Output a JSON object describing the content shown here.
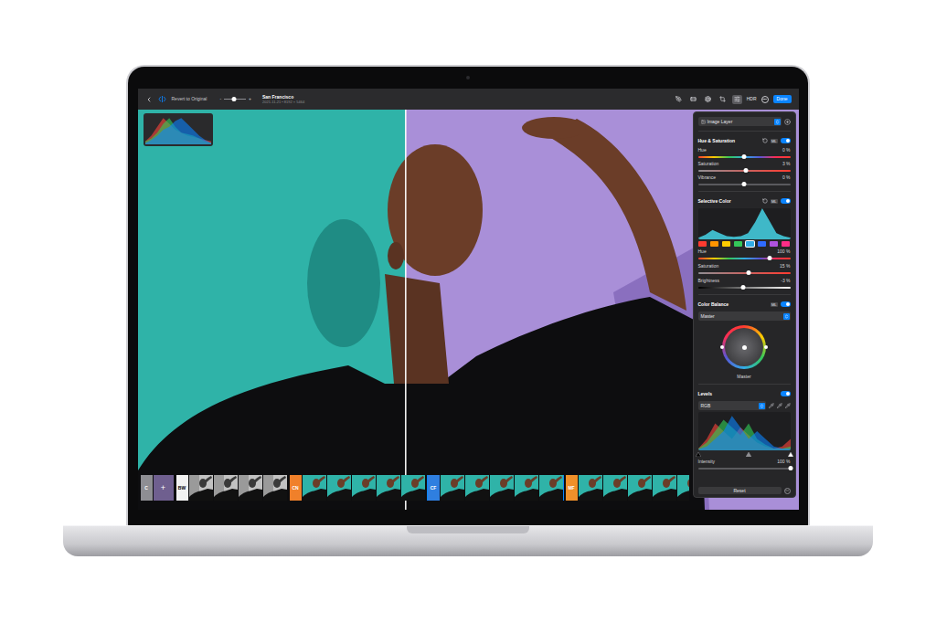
{
  "toolbar": {
    "revert": "Revert to Original",
    "zoom": {
      "minus": "-",
      "plus": "+",
      "level": 0.45
    },
    "title": "San Francisco",
    "subtitle": "2021-11-21 • 8192 × 5464",
    "tools": [
      {
        "selected": false
      },
      {
        "selected": false
      },
      {
        "selected": false
      },
      {
        "selected": false
      },
      {
        "selected": true
      }
    ],
    "hdr": "HDR",
    "done": "Done"
  },
  "canvas": {
    "split": 0.405,
    "histogram": {
      "red": [
        0.1,
        0.3,
        0.6,
        0.9,
        0.7,
        0.5,
        0.4,
        0.3,
        0.25,
        0.2,
        0.15,
        0.1
      ],
      "green": [
        0.1,
        0.2,
        0.4,
        0.7,
        0.9,
        0.6,
        0.4,
        0.35,
        0.3,
        0.2,
        0.1,
        0.05
      ],
      "blue": [
        0.05,
        0.15,
        0.3,
        0.5,
        0.6,
        0.8,
        0.9,
        0.7,
        0.5,
        0.3,
        0.15,
        0.05
      ]
    }
  },
  "inspector": {
    "layer": "Image Layer",
    "hue_saturation": {
      "title": "Hue & Saturation",
      "ml": "ML",
      "resettable": true,
      "enabled": true,
      "sliders": [
        {
          "label": "Hue",
          "reading": "0 %",
          "level": 0.5,
          "kind": "hue"
        },
        {
          "label": "Saturation",
          "reading": "3 %",
          "level": 0.52,
          "kind": "saturation"
        },
        {
          "label": "Vibrance",
          "reading": "0 %",
          "level": 0.5,
          "kind": "plain"
        }
      ]
    },
    "selective_color": {
      "title": "Selective Color",
      "ml": "ML",
      "resettable": true,
      "enabled": true,
      "histogram": [
        0.05,
        0.15,
        0.3,
        0.2,
        0.1,
        0.08,
        0.1,
        0.2,
        0.55,
        1.0,
        0.6,
        0.2,
        0.1,
        0.05
      ],
      "swatches": [
        {
          "color": "#ff3b30",
          "selected": false
        },
        {
          "color": "#ff9500",
          "selected": false
        },
        {
          "color": "#ffcc00",
          "selected": false
        },
        {
          "color": "#34c759",
          "selected": false
        },
        {
          "color": "#32ade6",
          "selected": true
        },
        {
          "color": "#2f6bff",
          "selected": false
        },
        {
          "color": "#af52de",
          "selected": false
        },
        {
          "color": "#ff2d87",
          "selected": false
        }
      ],
      "sliders": [
        {
          "label": "Hue",
          "reading": "100 %",
          "level": 0.78,
          "kind": "hue"
        },
        {
          "label": "Saturation",
          "reading": "15 %",
          "level": 0.55,
          "kind": "saturation"
        },
        {
          "label": "Brightness",
          "reading": "-3 %",
          "level": 0.49,
          "kind": "brightness"
        }
      ]
    },
    "color_balance": {
      "title": "Color Balance",
      "ml": "ML",
      "resettable": false,
      "enabled": true,
      "mode": "Master",
      "wheel_label": "Master"
    },
    "levels": {
      "title": "Levels",
      "enabled": true,
      "channel": "RGB",
      "histogram": {
        "red": [
          0.05,
          0.3,
          0.7,
          0.5,
          0.3,
          0.6,
          0.4,
          0.2,
          0.1,
          0.05,
          0.1,
          0.3
        ],
        "green": [
          0.05,
          0.2,
          0.5,
          0.8,
          0.6,
          0.4,
          0.7,
          0.3,
          0.15,
          0.05,
          0.05,
          0.1
        ],
        "blue": [
          0.03,
          0.1,
          0.3,
          0.5,
          0.9,
          0.6,
          0.3,
          0.5,
          0.3,
          0.1,
          0.05,
          0.05
        ]
      },
      "markers": [
        {
          "level": 0,
          "color": "#000000"
        },
        {
          "level": 0.55,
          "color": "#8e8e93"
        },
        {
          "level": 1,
          "color": "#ffffff"
        }
      ],
      "slider": {
        "label": "Intensity",
        "reading": "100 %",
        "level": 1,
        "kind": "plain"
      }
    },
    "reset": "Reset"
  },
  "presets": [
    {
      "label": "C",
      "color": "#8e8e93",
      "kind": "add",
      "add": "+",
      "thumbnails": 0,
      "selected": false
    },
    {
      "label": "BW",
      "color": "#f2f2f2",
      "kind": "mono",
      "add": "",
      "thumbnails": 4,
      "selected": false
    },
    {
      "label": "CN",
      "color": "#f0802a",
      "kind": "color",
      "add": "",
      "thumbnails": 5,
      "selected": false
    },
    {
      "label": "CF",
      "color": "#2f7fe0",
      "kind": "color",
      "add": "",
      "thumbnails": 5,
      "selected": true
    },
    {
      "label": "MF",
      "color": "#f0902a",
      "kind": "color",
      "add": "",
      "thumbnails": 5,
      "selected": false
    }
  ]
}
